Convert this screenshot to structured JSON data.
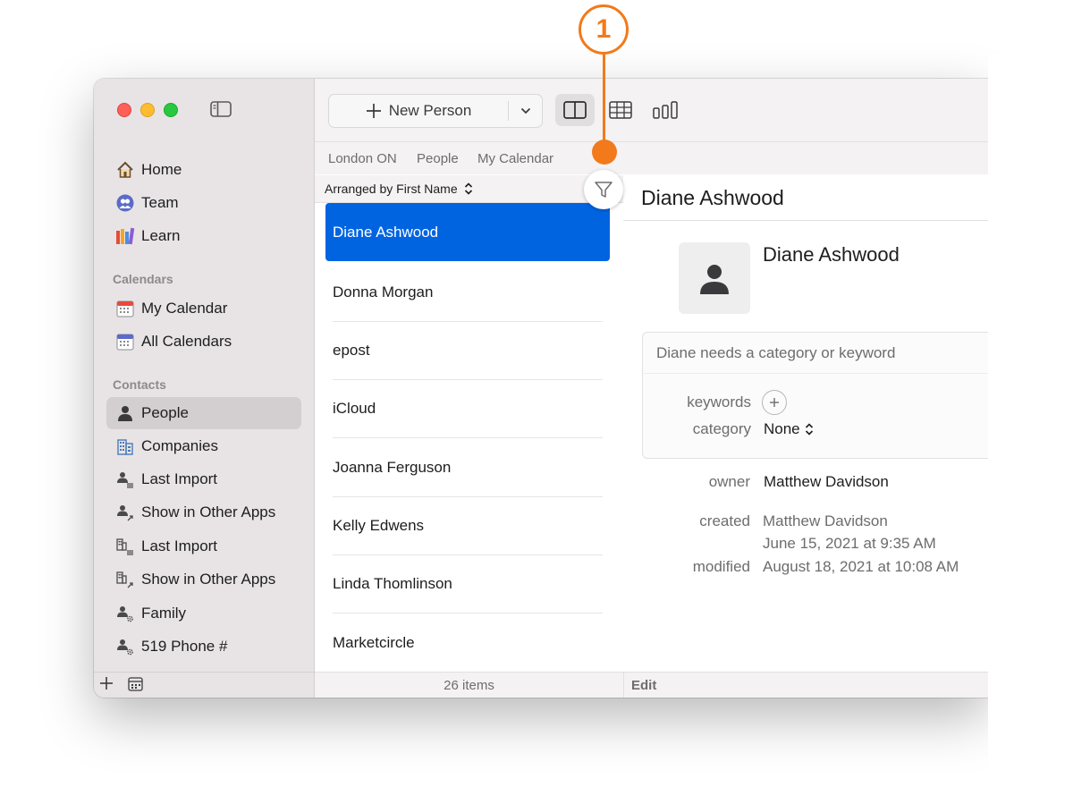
{
  "callout": {
    "number": "1"
  },
  "toolbar": {
    "new_person_label": "New Person",
    "view_icons": [
      "split-view-icon",
      "table-view-icon",
      "column-view-icon"
    ]
  },
  "breadcrumbs": [
    "London ON",
    "People",
    "My Calendar"
  ],
  "sidebar": {
    "main_items": [
      {
        "label": "Home",
        "icon": "home-icon"
      },
      {
        "label": "Team",
        "icon": "team-icon"
      },
      {
        "label": "Learn",
        "icon": "books-icon"
      }
    ],
    "calendars_header": "Calendars",
    "calendar_items": [
      {
        "label": "My Calendar",
        "icon": "calendar-icon"
      },
      {
        "label": "All Calendars",
        "icon": "calendar-icon"
      }
    ],
    "contacts_header": "Contacts",
    "contact_items": [
      {
        "label": "People",
        "icon": "person-icon",
        "selected": true
      },
      {
        "label": "Companies",
        "icon": "building-icon"
      },
      {
        "label": "Last Import",
        "icon": "person-list-icon"
      },
      {
        "label": "Show in Other Apps",
        "icon": "person-arrow-icon"
      },
      {
        "label": "Last Import",
        "icon": "company-list-icon"
      },
      {
        "label": "Show in Other Apps",
        "icon": "company-arrow-icon"
      },
      {
        "label": "Family",
        "icon": "person-gear-icon"
      },
      {
        "label": "519 Phone #",
        "icon": "person-gear-icon"
      }
    ]
  },
  "list": {
    "arranged_by": "Arranged by First Name",
    "rows": [
      "Diane Ashwood",
      "Donna Morgan",
      "epost",
      "iCloud",
      "Joanna Ferguson",
      "Kelly Edwens",
      "Linda Thomlinson",
      "Marketcircle"
    ],
    "selected_index": 0,
    "count_label": "26 items"
  },
  "detail": {
    "header_title": "Diane Ashwood",
    "name": "Diane Ashwood",
    "hint": "Diane needs a category or keyword",
    "keywords_label": "keywords",
    "category_label": "category",
    "category_value": "None",
    "owner_label": "owner",
    "owner_value": "Matthew Davidson",
    "created_label": "created",
    "created_by": "Matthew Davidson",
    "created_date": "June 15, 2021 at 9:35 AM",
    "modified_label": "modified",
    "modified_date": "August 18, 2021 at 10:08 AM",
    "edit_label": "Edit"
  },
  "colors": {
    "accent": "#0064e1",
    "callout": "#f27a1a",
    "sidebar_bg": "#e8e4e6"
  }
}
